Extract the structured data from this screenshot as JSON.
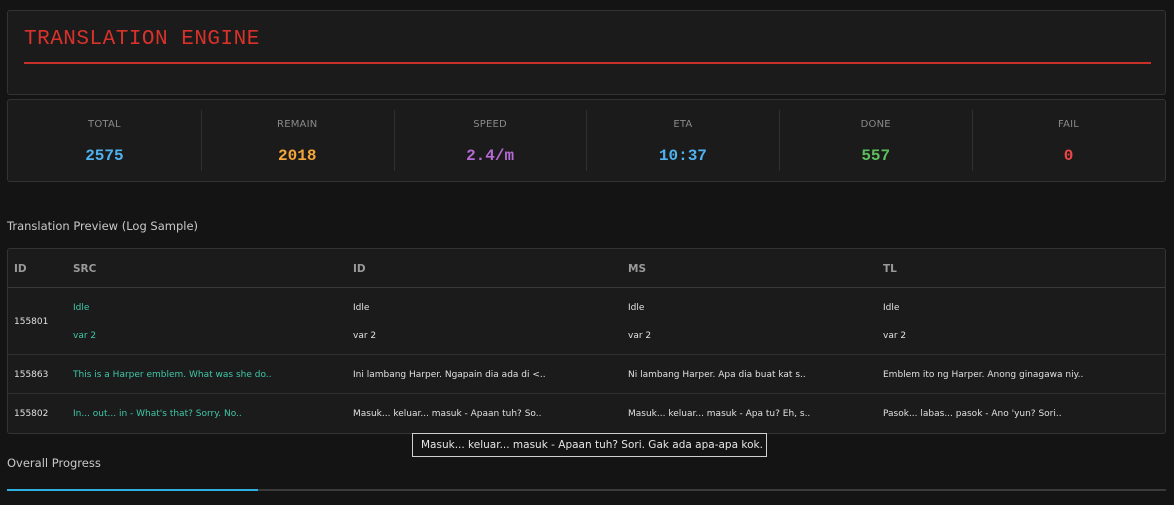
{
  "app": {
    "title": "TRANSLATION ENGINE",
    "title_color": "#d9322b"
  },
  "stats": [
    {
      "label": "TOTAL",
      "value": "2575",
      "color": "#4fb3f0"
    },
    {
      "label": "REMAIN",
      "value": "2018",
      "color": "#f5a53a"
    },
    {
      "label": "SPEED",
      "value": "2.4/m",
      "color": "#b66ad8"
    },
    {
      "label": "ETA",
      "value": "10:37",
      "color": "#4fb3f0"
    },
    {
      "label": "DONE",
      "value": "557",
      "color": "#5cbf5c"
    },
    {
      "label": "FAIL",
      "value": "0",
      "color": "#ef4747"
    }
  ],
  "preview": {
    "title": "Translation Preview (Log Sample)",
    "columns": [
      "ID",
      "SRC",
      "ID",
      "MS",
      "TL"
    ],
    "rows": [
      {
        "id": "155801",
        "src": [
          "Idle",
          "var 2"
        ],
        "id_text": [
          "Idle",
          "var 2"
        ],
        "ms": [
          "Idle",
          "var 2"
        ],
        "tl": [
          "Idle",
          "var 2"
        ]
      },
      {
        "id": "155863",
        "src": "This is a Harper emblem. What was she do..",
        "id_text": "Ini lambang Harper. Ngapain dia ada di <..",
        "ms": "Ni lambang Harper. Apa dia buat kat s..",
        "tl": "Emblem ito ng Harper. Anong ginagawa niy.."
      },
      {
        "id": "155802",
        "src": "In... out... in - What's that? Sorry. No..",
        "id_text": "Masuk... keluar... masuk - Apaan tuh? So..",
        "ms": "Masuk... keluar... masuk - Apa tu? Eh, s..",
        "tl": "Pasok... labas... pasok - Ano 'yun? Sori.."
      }
    ]
  },
  "tooltip": {
    "text": "Masuk... keluar... masuk - Apaan tuh? Sori. Gak ada apa-apa kok."
  },
  "progress": {
    "title": "Overall Progress",
    "fraction": 0.2163,
    "color": "#2fb0e0"
  }
}
